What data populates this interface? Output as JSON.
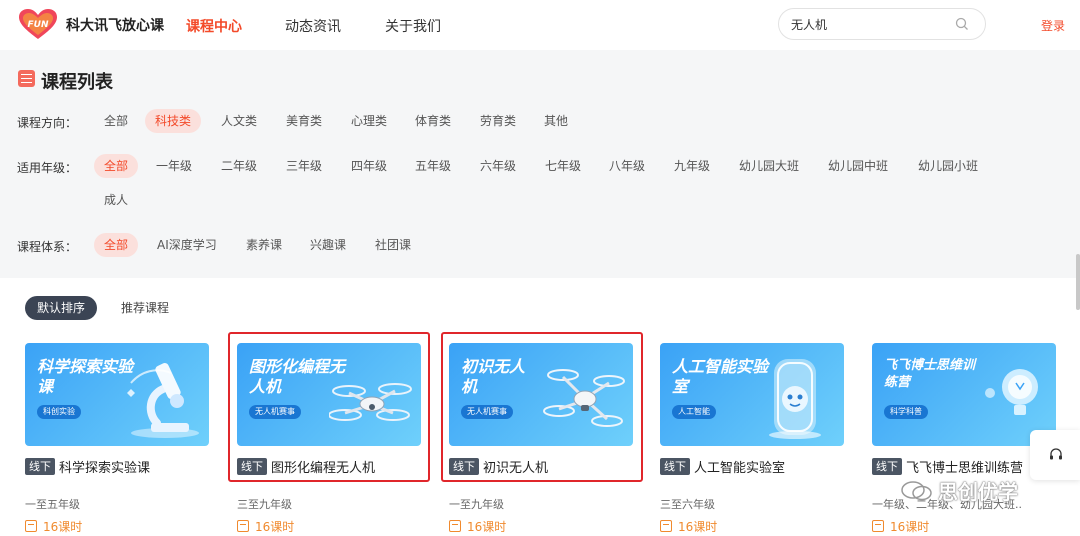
{
  "header": {
    "logo_text": "FUN",
    "brand": "科大讯飞放心课",
    "nav": [
      {
        "label": "课程中心",
        "active": true
      },
      {
        "label": "动态资讯",
        "active": false
      },
      {
        "label": "关于我们",
        "active": false
      }
    ],
    "search": {
      "value": "无人机",
      "icon": "search-icon"
    },
    "login": "登录"
  },
  "panel": {
    "title": "课程列表",
    "rows": [
      {
        "label": "课程方向：",
        "options": [
          "全部",
          "科技类",
          "人文类",
          "美育类",
          "心理类",
          "体育类",
          "劳育类",
          "其他"
        ],
        "selected": "科技类"
      },
      {
        "label": "适用年级：",
        "options": [
          "全部",
          "一年级",
          "二年级",
          "三年级",
          "四年级",
          "五年级",
          "六年级",
          "七年级",
          "八年级",
          "九年级",
          "幼儿园大班",
          "幼儿园中班",
          "幼儿园小班",
          "成人"
        ],
        "selected": "全部"
      },
      {
        "label": "课程体系：",
        "options": [
          "全部",
          "AI深度学习",
          "素养课",
          "兴趣课",
          "社团课"
        ],
        "selected": "全部"
      }
    ]
  },
  "sort": {
    "tabs": [
      "默认排序",
      "推荐课程"
    ],
    "selected": "默认排序"
  },
  "cards": [
    {
      "thumb_title": "科学探索实验课",
      "thumb_tag": "科创实验",
      "badge": "线下",
      "title": "科学探索实验课",
      "grade": "一至五年级",
      "hours": "16课时",
      "highlighted": false
    },
    {
      "thumb_title": "图形化编程无人机",
      "thumb_tag": "无人机赛事",
      "badge": "线下",
      "title": "图形化编程无人机",
      "grade": "三至九年级",
      "hours": "16课时",
      "highlighted": true
    },
    {
      "thumb_title": "初识无人机",
      "thumb_tag": "无人机赛事",
      "badge": "线下",
      "title": "初识无人机",
      "grade": "一至九年级",
      "hours": "16课时",
      "highlighted": true
    },
    {
      "thumb_title": "人工智能实验室",
      "thumb_tag": "人工智能",
      "badge": "线下",
      "title": "人工智能实验室",
      "grade": "三至六年级",
      "hours": "16课时",
      "highlighted": false
    },
    {
      "thumb_title": "飞飞博士思维训练营",
      "thumb_tag": "科学科普",
      "badge": "线下",
      "title": "飞飞博士思维训练营",
      "grade": "一年级、二年级、幼儿园大班...",
      "hours": "16课时",
      "highlighted": false
    }
  ],
  "watermark": "思创优学",
  "colors": {
    "accent": "#f34a2a",
    "chip_active_bg": "#fbe0dc",
    "panel_bg": "#f5f6f7",
    "thumb_blue": "#3aa2f6",
    "highlight_red": "#e0262b"
  }
}
